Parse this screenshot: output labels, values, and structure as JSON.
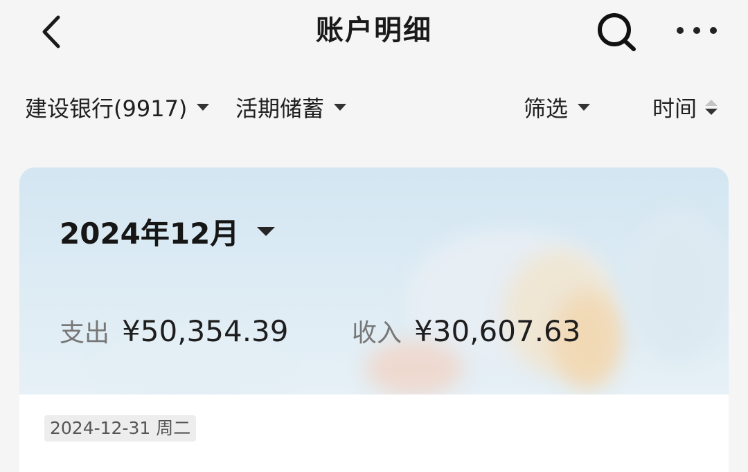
{
  "header": {
    "title": "账户明细",
    "back_icon": "chevron-left-icon",
    "search_icon": "search-icon",
    "more_icon": "more-horizontal-icon"
  },
  "filters": {
    "account": "建设银行(9917)",
    "account_type": "活期储蓄",
    "filter": "筛选",
    "sort": "时间"
  },
  "summary": {
    "month": "2024年12月",
    "expense_label": "支出",
    "expense_value": "¥50,354.39",
    "income_label": "收入",
    "income_value": "¥30,607.63"
  },
  "transactions": {
    "date_header": "2024-12-31 周二"
  },
  "colors": {
    "background": "#f5f5f5",
    "card_banner": "#d8e8f3",
    "text_primary": "#1a1a1a",
    "text_secondary": "#777777"
  }
}
